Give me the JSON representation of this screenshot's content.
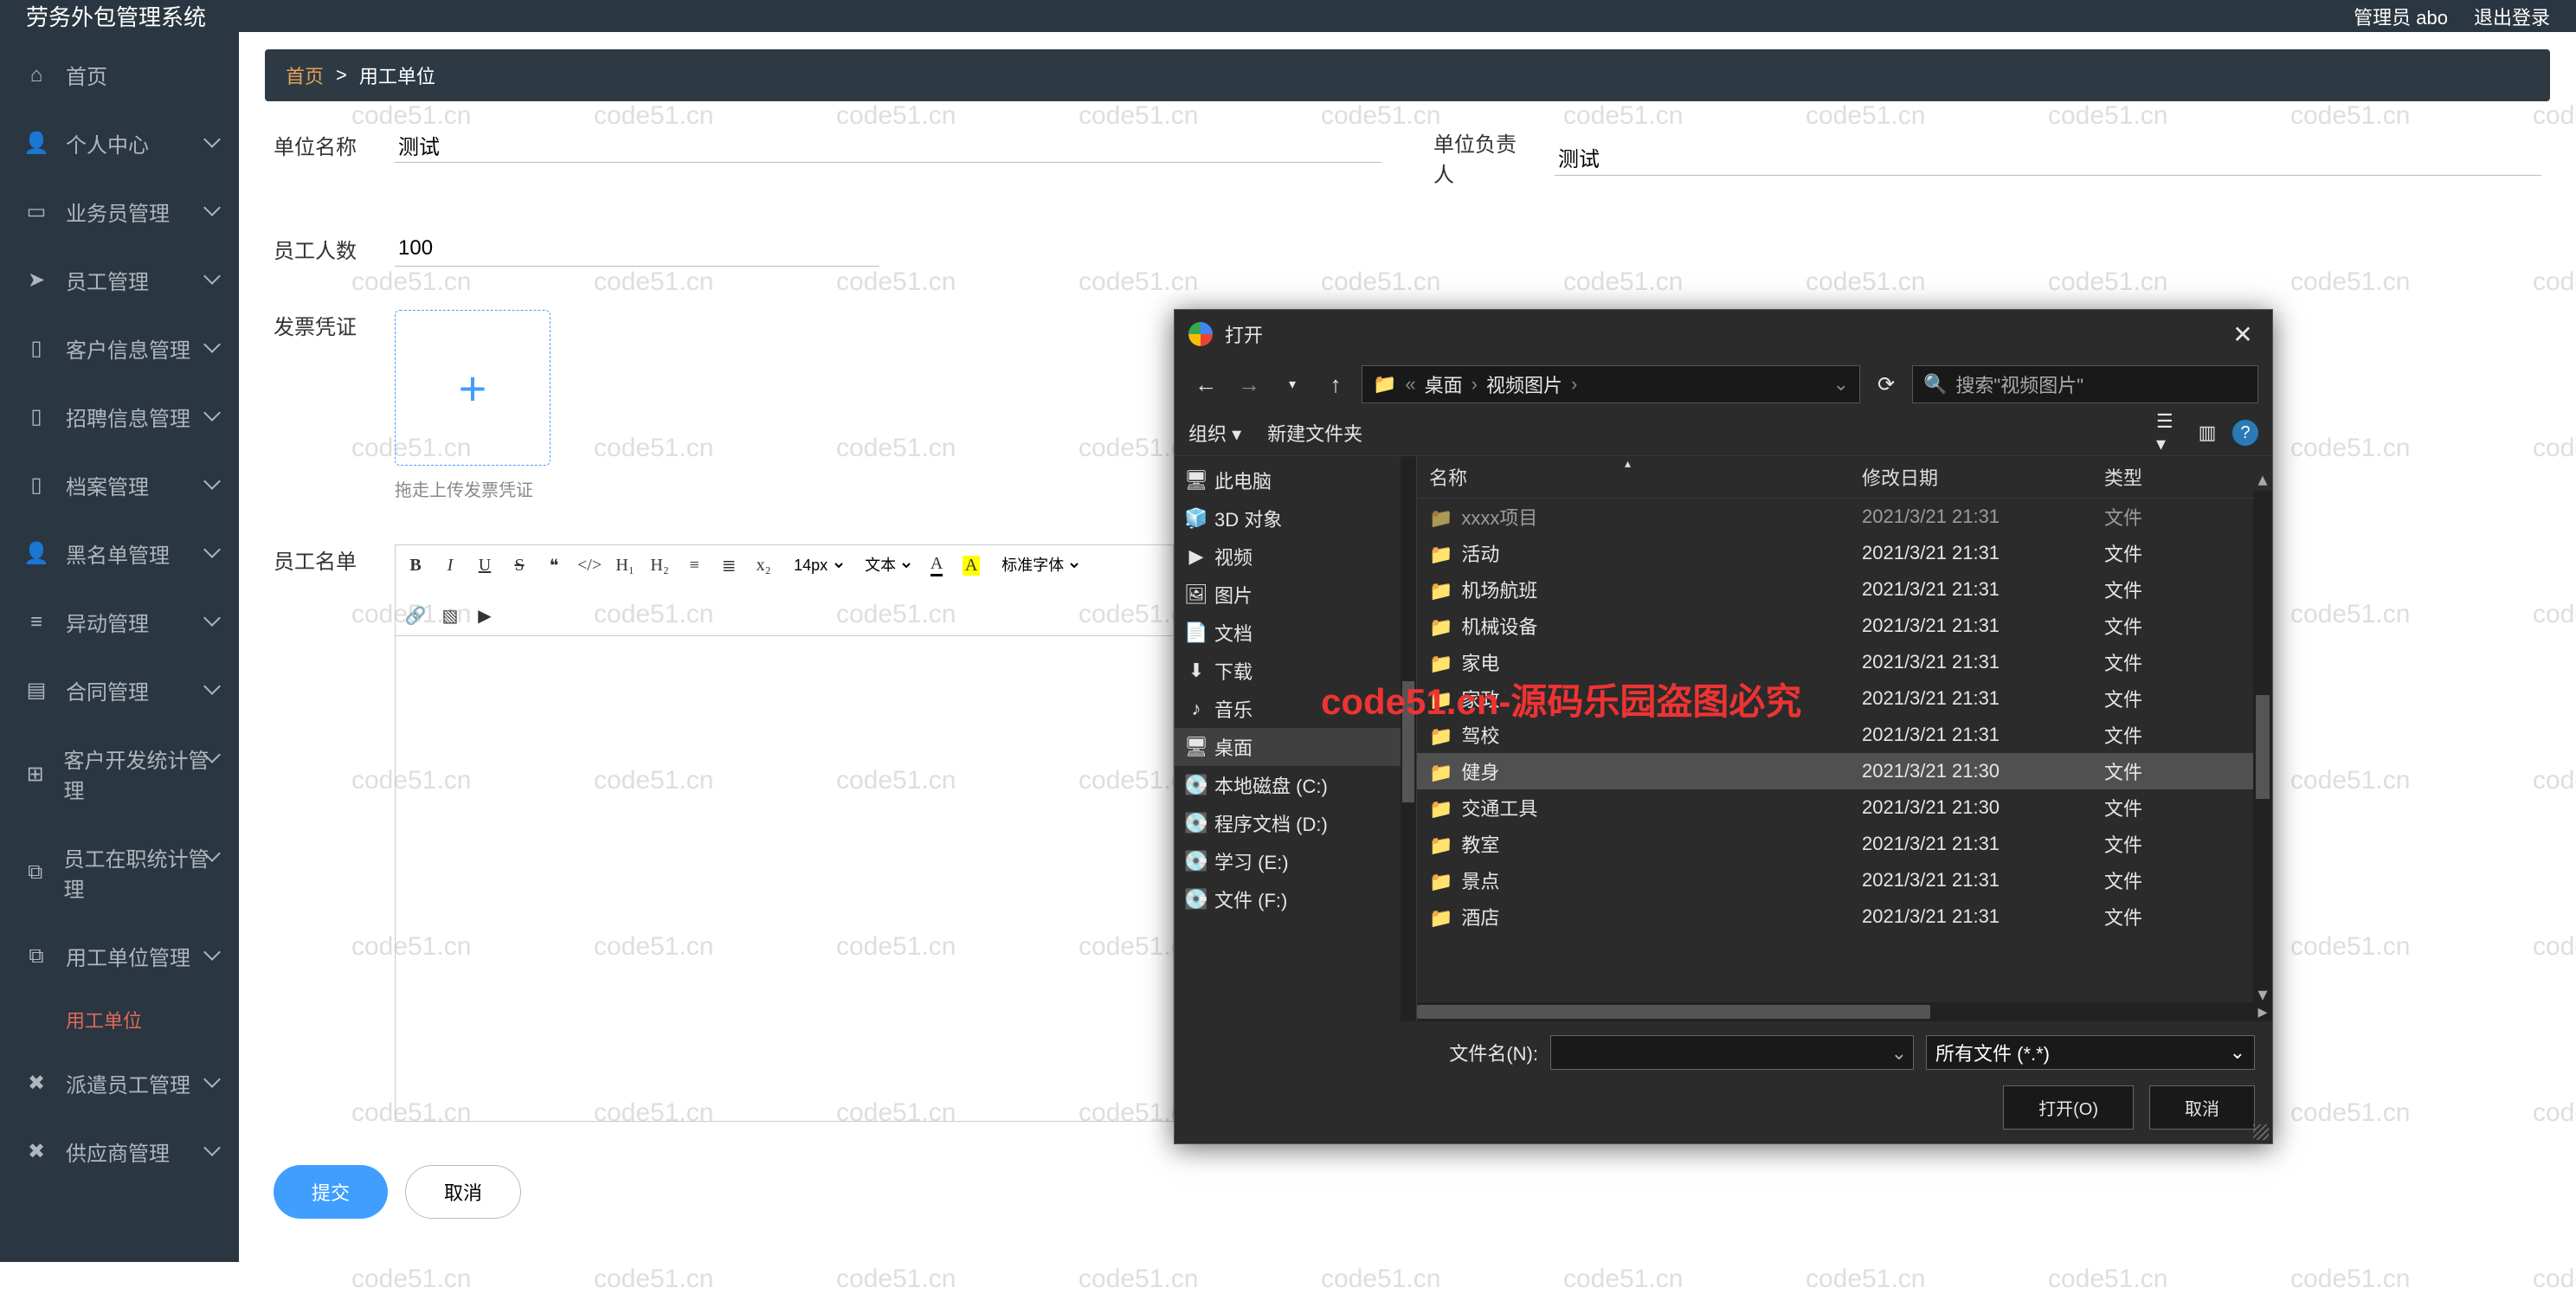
{
  "topbar": {
    "title": "劳务外包管理系统",
    "admin": "管理员 abo",
    "logout": "退出登录"
  },
  "sidebar": {
    "items": [
      {
        "label": "首页",
        "icon": "home"
      },
      {
        "label": "个人中心",
        "icon": "user"
      },
      {
        "label": "业务员管理",
        "icon": "card"
      },
      {
        "label": "员工管理",
        "icon": "send"
      },
      {
        "label": "客户信息管理",
        "icon": "book"
      },
      {
        "label": "招聘信息管理",
        "icon": "book"
      },
      {
        "label": "档案管理",
        "icon": "book"
      },
      {
        "label": "黑名单管理",
        "icon": "user"
      },
      {
        "label": "异动管理",
        "icon": "list"
      },
      {
        "label": "合同管理",
        "icon": "file"
      },
      {
        "label": "客户开发统计管理",
        "icon": "grid"
      },
      {
        "label": "员工在职统计管理",
        "icon": "copy"
      },
      {
        "label": "用工单位管理",
        "icon": "copy"
      },
      {
        "label": "派遣员工管理",
        "icon": "cross"
      },
      {
        "label": "供应商管理",
        "icon": "cross"
      }
    ],
    "sub_active": "用工单位"
  },
  "breadcrumb": {
    "home": "首页",
    "current": "用工单位"
  },
  "form": {
    "unit_name_label": "单位名称",
    "unit_name_value": "测试",
    "unit_person_label": "单位负责人",
    "unit_person_value": "测试",
    "staff_count_label": "员工人数",
    "staff_count_value": "100",
    "invoice_label": "发票凭证",
    "invoice_hint": "拖走上传发票凭证",
    "staff_list_label": "员工名单",
    "editor_fontsize": "14px",
    "editor_fontstyle": "文本",
    "editor_fontfamily": "标准字体",
    "submit": "提交",
    "cancel": "取消"
  },
  "file_dialog": {
    "title": "打开",
    "path_crumbs": [
      "桌面",
      "视频图片"
    ],
    "search_placeholder": "搜索\"视频图片\"",
    "organize": "组织",
    "new_folder": "新建文件夹",
    "tree": [
      {
        "label": "此电脑",
        "icon": "pc"
      },
      {
        "label": "3D 对象",
        "icon": "3d"
      },
      {
        "label": "视频",
        "icon": "video"
      },
      {
        "label": "图片",
        "icon": "picture"
      },
      {
        "label": "文档",
        "icon": "doc"
      },
      {
        "label": "下载",
        "icon": "download"
      },
      {
        "label": "音乐",
        "icon": "music"
      },
      {
        "label": "桌面",
        "icon": "desktop",
        "selected": true
      },
      {
        "label": "本地磁盘 (C:)",
        "icon": "disk"
      },
      {
        "label": "程序文档 (D:)",
        "icon": "disk"
      },
      {
        "label": "学习 (E:)",
        "icon": "disk"
      },
      {
        "label": "文件 (F:)",
        "icon": "disk"
      }
    ],
    "columns": {
      "name": "名称",
      "date": "修改日期",
      "type": "类型"
    },
    "rows": [
      {
        "name": "xxxx项目",
        "date": "2021/3/21 21:31",
        "type": "文件",
        "dim": true
      },
      {
        "name": "活动",
        "date": "2021/3/21 21:31",
        "type": "文件"
      },
      {
        "name": "机场航班",
        "date": "2021/3/21 21:31",
        "type": "文件"
      },
      {
        "name": "机械设备",
        "date": "2021/3/21 21:31",
        "type": "文件"
      },
      {
        "name": "家电",
        "date": "2021/3/21 21:31",
        "type": "文件"
      },
      {
        "name": "家政",
        "date": "2021/3/21 21:31",
        "type": "文件"
      },
      {
        "name": "驾校",
        "date": "2021/3/21 21:31",
        "type": "文件"
      },
      {
        "name": "健身",
        "date": "2021/3/21 21:30",
        "type": "文件",
        "selected": true
      },
      {
        "name": "交通工具",
        "date": "2021/3/21 21:30",
        "type": "文件"
      },
      {
        "name": "教室",
        "date": "2021/3/21 21:31",
        "type": "文件"
      },
      {
        "name": "景点",
        "date": "2021/3/21 21:31",
        "type": "文件"
      },
      {
        "name": "酒店",
        "date": "2021/3/21 21:31",
        "type": "文件"
      }
    ],
    "filename_label": "文件名(N):",
    "filter": "所有文件 (*.*)",
    "open": "打开(O)",
    "cancel": "取消"
  },
  "watermark": {
    "text": "code51.cn",
    "red": "code51.cn-源码乐园盗图必究"
  }
}
